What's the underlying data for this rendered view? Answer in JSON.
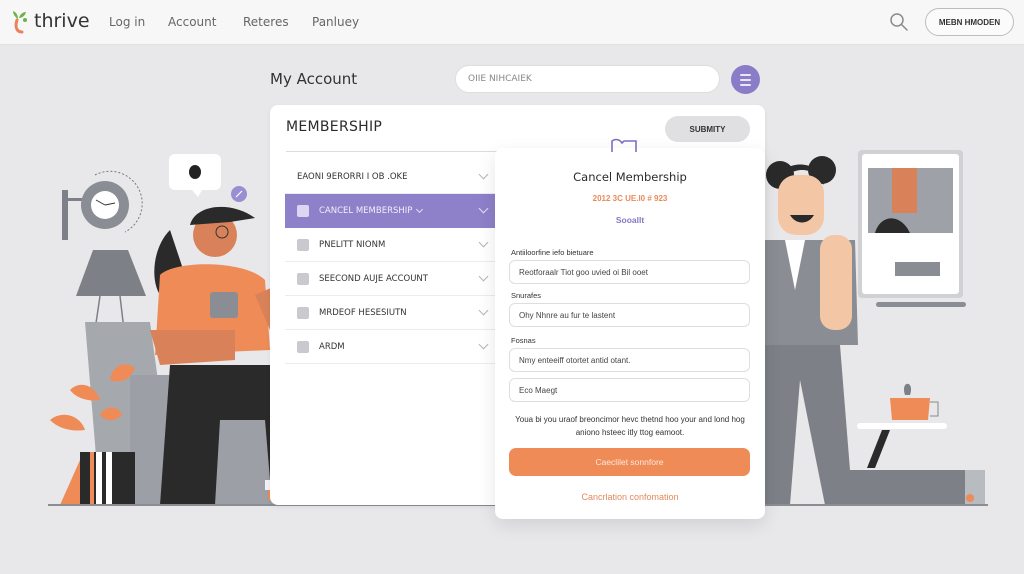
{
  "brand": {
    "name": "thrive",
    "accent": "#8e80c9",
    "orange": "#ee8b57"
  },
  "nav": {
    "links": [
      "Log in",
      "Account",
      "Reteres",
      "Panluey"
    ],
    "search_icon": "search-icon",
    "member_button": "MEBN HMODEN"
  },
  "account": {
    "title": "My Account",
    "search_placeholder": "OIIE NIHCAIEK",
    "menu_icon": "hamburger-icon"
  },
  "membership": {
    "title": "MEMBERSHIP",
    "submit_label": "SUBMITY",
    "items": [
      {
        "label": "EAONI 9ERORRI I OB .OKE",
        "icon": "none",
        "active": false
      },
      {
        "label": "CANCEL MEMBERSHIP",
        "icon": "id-card-icon",
        "active": true
      },
      {
        "label": "PNELITT NIONM",
        "icon": "scissors-icon",
        "active": false
      },
      {
        "label": "SEECOND AUJE ACCOUNT",
        "icon": "user-icon",
        "active": false
      },
      {
        "label": "MRDEOF HESESIUTN",
        "icon": "document-icon",
        "active": false
      },
      {
        "label": "ARDM",
        "icon": "puzzle-icon",
        "active": false
      }
    ]
  },
  "cancel_dialog": {
    "title": "Cancel Membership",
    "subtitle": "2012 3C UE.I0 # 923",
    "link": "Sooallt",
    "fields": [
      {
        "label": "Antiiloorfine iefo bietuare",
        "value": "Reotforaalr Tiot goo uvied oi Bil ooet"
      },
      {
        "label": "Snurafes",
        "value": "Ohy Nhnre au fur te lastent"
      },
      {
        "label": "Fosnas",
        "value": "Nmy enteeiff otortet antid otant."
      },
      {
        "label": "",
        "value": "Eco Maegt"
      }
    ],
    "note": "Youa bi you uraof breoncimor hevc thetnd hoo your and lond hog aniono hsteec itly ttog eamoot.",
    "primary_button": "Caeclilet sonnfore",
    "confirm_link": "Cancrlation confomation"
  }
}
